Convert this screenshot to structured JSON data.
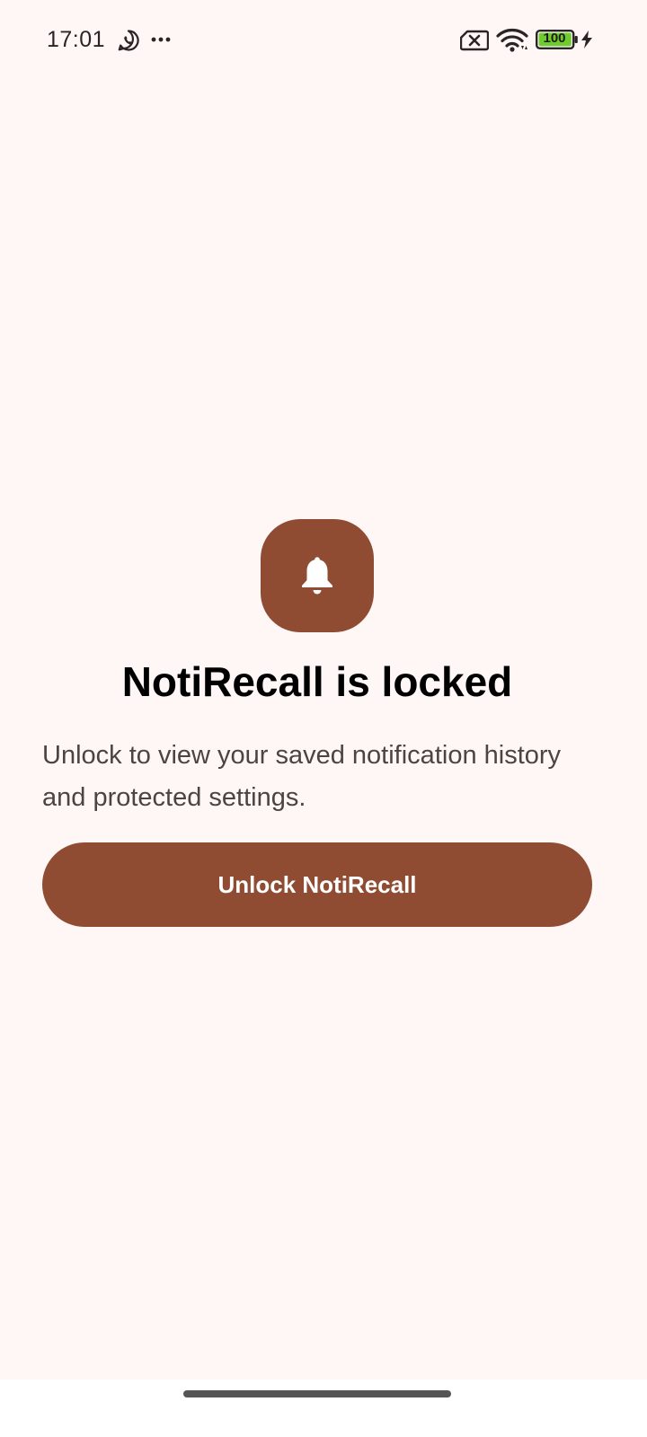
{
  "status_bar": {
    "time": "17:01",
    "icons": [
      "whatsapp-icon",
      "more-icon",
      "sim-icon",
      "wifi-icon",
      "battery-icon",
      "charging-icon"
    ],
    "battery_level": "100",
    "battery_fill_color": "#6FCB2E"
  },
  "lock_screen": {
    "app_icon": "bell-icon",
    "title": "NotiRecall is locked",
    "message": "Unlock to view your saved notification history and protected settings.",
    "unlock_button_label": "Unlock NotiRecall"
  },
  "colors": {
    "background": "#FFF7F5",
    "accent": "#904C33",
    "on_accent": "#FFFFFF",
    "title_text": "#000000",
    "body_text": "#4A4442"
  }
}
